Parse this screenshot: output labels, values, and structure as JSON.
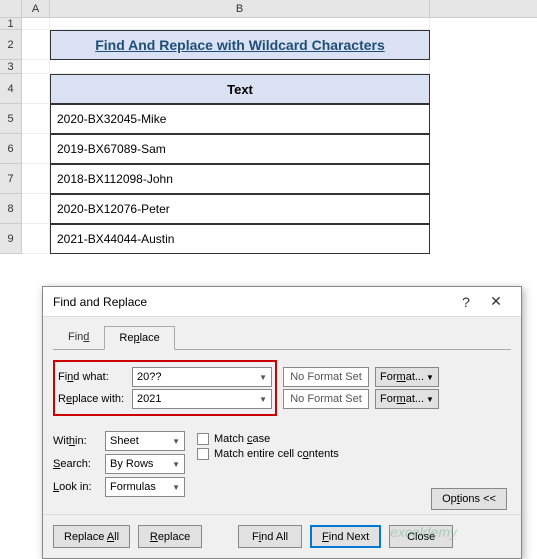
{
  "columns": {
    "a": "A",
    "b": "B"
  },
  "row_nums": [
    "1",
    "2",
    "3",
    "4",
    "5",
    "6",
    "7",
    "8",
    "9"
  ],
  "title": "Find And Replace with Wildcard Characters",
  "table": {
    "header": "Text",
    "rows": [
      "2020-BX32045-Mike",
      "2019-BX67089-Sam",
      "2018-BX112098-John",
      "2020-BX12076-Peter",
      "2021-BX44044-Austin"
    ]
  },
  "dialog": {
    "title": "Find and Replace",
    "help": "?",
    "close": "✕",
    "tabs": {
      "find": "Find",
      "replace": "Replace"
    },
    "find_label": "Find what:",
    "find_value": "20??",
    "replace_label": "Replace with:",
    "replace_value": "2021",
    "no_format": "No Format Set",
    "format_btn": "Format...",
    "within_label": "Within:",
    "within_value": "Sheet",
    "search_label": "Search:",
    "search_value": "By Rows",
    "lookin_label": "Look in:",
    "lookin_value": "Formulas",
    "match_case": "Match case",
    "match_entire": "Match entire cell contents",
    "options_btn": "Options <<",
    "buttons": {
      "replace_all": "Replace All",
      "replace": "Replace",
      "find_all": "Find All",
      "find_next": "Find Next",
      "close": "Close"
    }
  },
  "watermark": "exceldemy"
}
